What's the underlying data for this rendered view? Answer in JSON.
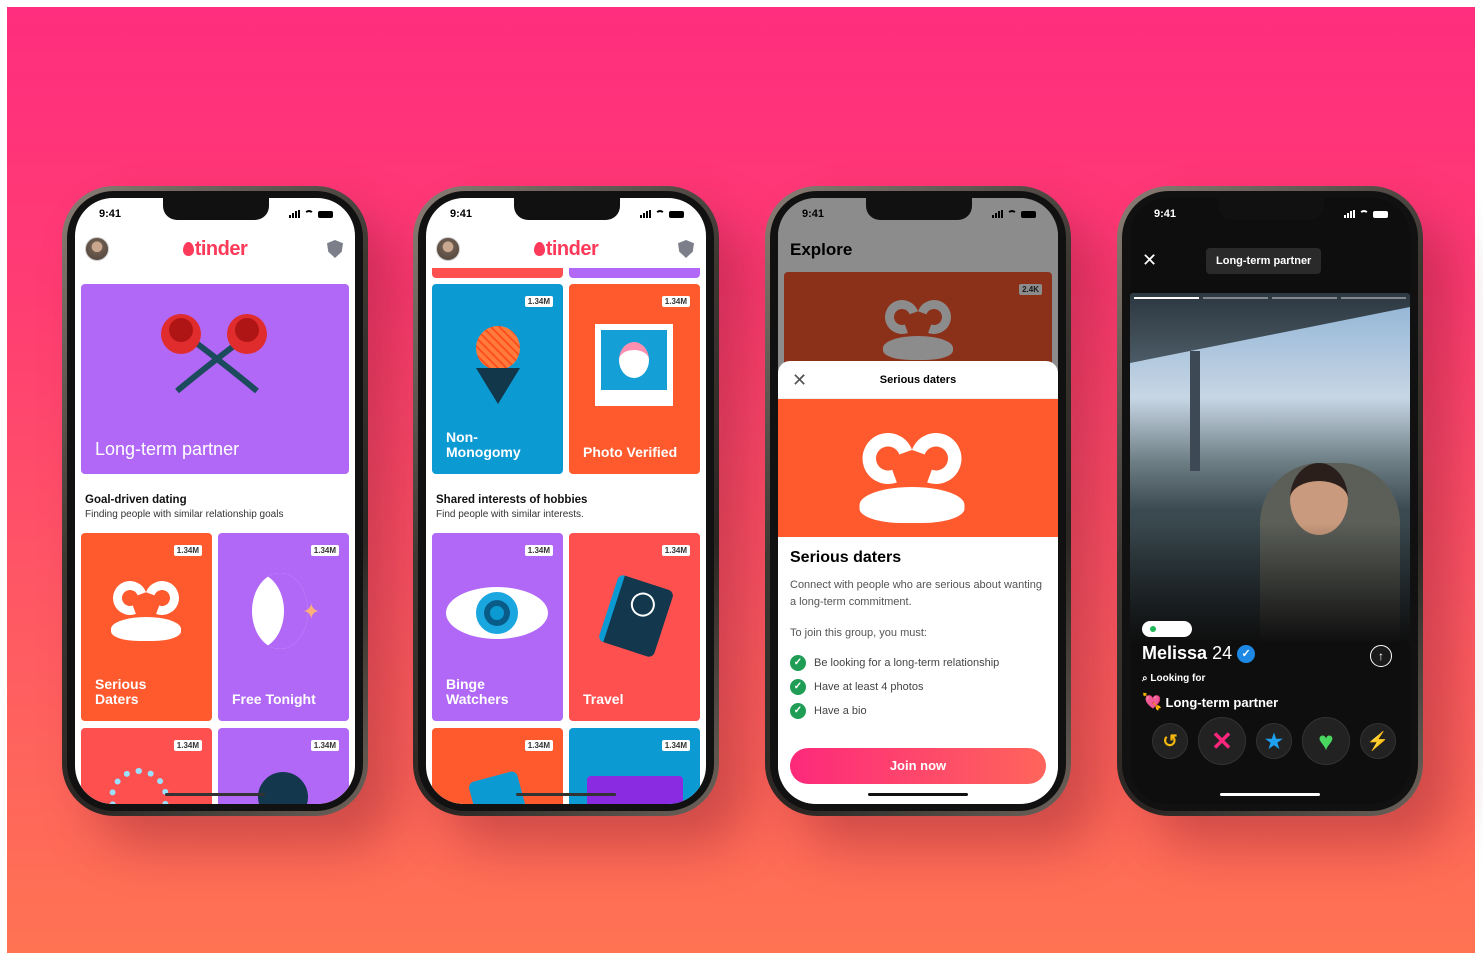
{
  "status_time": "9:41",
  "phone1": {
    "brand": "tinder",
    "hero_label": "Long-term partner",
    "section_title": "Goal-driven dating",
    "section_sub": "Finding people with similar relationship goals",
    "cards": [
      {
        "label": "Serious Daters",
        "badge": "1.34M"
      },
      {
        "label": "Free Tonight",
        "badge": "1.34M"
      },
      {
        "label": "",
        "badge": "1.34M"
      },
      {
        "label": "",
        "badge": "1.34M"
      }
    ]
  },
  "phone2": {
    "brand": "tinder",
    "top_cards": [
      {
        "label": "Non-\nMonogomy",
        "badge": "1.34M"
      },
      {
        "label": "Photo Verified",
        "badge": "1.34M"
      }
    ],
    "section_title": "Shared interests of hobbies",
    "section_sub": "Find people with similar interests.",
    "cards": [
      {
        "label": "Binge\nWatchers",
        "badge": "1.34M"
      },
      {
        "label": "Travel",
        "badge": "1.34M"
      },
      {
        "label": "",
        "badge": "1.34M"
      },
      {
        "label": "",
        "badge": "1.34M"
      }
    ]
  },
  "phone3": {
    "page_title": "Explore",
    "bg_badge": "2.4K",
    "sheet_header": "Serious daters",
    "title": "Serious daters",
    "description": "Connect with people who are serious about wanting a long-term commitment.",
    "requirements_intro": "To join this group, you must:",
    "requirements": [
      "Be looking for a long-term relationship",
      "Have at least 4 photos",
      "Have a bio"
    ],
    "join_label": "Join now"
  },
  "phone4": {
    "chip": "Long-term partner",
    "name": "Melissa",
    "age": "24",
    "looking_for_label": "Looking for",
    "looking_for_value": "Long-term partner",
    "colors": {
      "rewind": "#f5b80f",
      "nope": "#fd267d",
      "super": "#1ea1f1",
      "like": "#4ad760",
      "boost": "#a63cf2"
    }
  }
}
